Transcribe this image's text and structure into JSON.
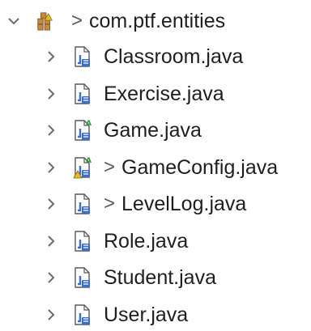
{
  "package": {
    "dirty_marker": ">",
    "name": "com.ptf.entities",
    "expanded": true
  },
  "files": [
    {
      "name": "Classroom.java",
      "dirty": false,
      "dirty_marker": "",
      "abstract": false,
      "warning": false
    },
    {
      "name": "Exercise.java",
      "dirty": false,
      "dirty_marker": "",
      "abstract": false,
      "warning": false
    },
    {
      "name": "Game.java",
      "dirty": false,
      "dirty_marker": "",
      "abstract": true,
      "warning": false
    },
    {
      "name": "GameConfig.java",
      "dirty": true,
      "dirty_marker": ">",
      "abstract": true,
      "warning": true
    },
    {
      "name": "LevelLog.java",
      "dirty": true,
      "dirty_marker": ">",
      "abstract": false,
      "warning": false
    },
    {
      "name": "Role.java",
      "dirty": false,
      "dirty_marker": "",
      "abstract": false,
      "warning": false
    },
    {
      "name": "Student.java",
      "dirty": false,
      "dirty_marker": "",
      "abstract": false,
      "warning": false
    },
    {
      "name": "User.java",
      "dirty": false,
      "dirty_marker": "",
      "abstract": false,
      "warning": false
    }
  ],
  "colors": {
    "text": "#1f1f1f",
    "chevron": "#6b6b6b",
    "file_icon_blue": "#3b6fc7",
    "package_brown": "#b07a3a",
    "abstract_green": "#2e9a3e",
    "warning_yellow": "#e8b923"
  }
}
